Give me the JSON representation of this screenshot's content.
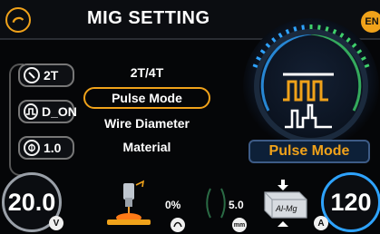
{
  "header": {
    "title": "MIG SETTING",
    "lang_label": "EN"
  },
  "left_panel": {
    "items": [
      {
        "icon": "trigger-icon",
        "value": "2T"
      },
      {
        "icon": "pulse-wave-icon",
        "value": "D_ON"
      },
      {
        "icon": "diameter-icon",
        "value": "1.0"
      }
    ]
  },
  "menu": {
    "items": [
      {
        "label": "2T/4T"
      },
      {
        "label": "Pulse Mode"
      },
      {
        "label": "Wire Diameter"
      },
      {
        "label": "Material"
      }
    ],
    "selected_index": 1
  },
  "gauge": {
    "mode_label": "Pulse Mode",
    "accent": "#f0a21a",
    "ring_green": "#3fd06b",
    "ring_blue": "#2ea3ff"
  },
  "bottom": {
    "voltage": {
      "value": "20.0",
      "unit": "V"
    },
    "inductance": {
      "value": "0%"
    },
    "wire_speed": {
      "value": "5.0",
      "unit": "mm"
    },
    "material": {
      "label": "Al-Mg"
    },
    "current": {
      "value": "120",
      "unit": "A"
    }
  }
}
